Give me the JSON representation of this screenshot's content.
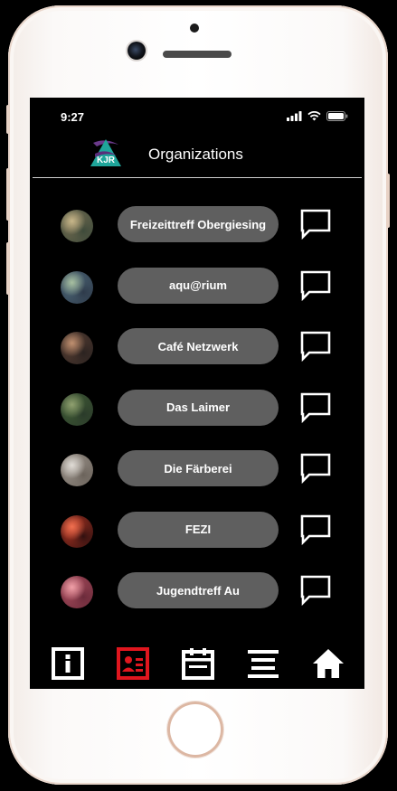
{
  "status_bar": {
    "time": "9:27"
  },
  "header": {
    "title": "Organizations",
    "logo_text": "KJR"
  },
  "organizations": [
    {
      "name": "Freizeittreff Obergiesing",
      "avatar_colors": [
        "#8a7a5a",
        "#c8b78a",
        "#3d4a3a"
      ]
    },
    {
      "name": "aqu@rium",
      "avatar_colors": [
        "#5a7a8a",
        "#a8c0a0",
        "#2e3a4a"
      ]
    },
    {
      "name": "Café Netzwerk",
      "avatar_colors": [
        "#6a4a3a",
        "#c09070",
        "#2a2220"
      ]
    },
    {
      "name": "Das Laimer",
      "avatar_colors": [
        "#4a6a3a",
        "#90a070",
        "#2a3a2a"
      ]
    },
    {
      "name": "Die Färberei",
      "avatar_colors": [
        "#b0a8a0",
        "#e0dcd6",
        "#6a625a"
      ]
    },
    {
      "name": "FEZI",
      "avatar_colors": [
        "#e0442a",
        "#f07050",
        "#301010"
      ]
    },
    {
      "name": "Jugendtreff Au",
      "avatar_colors": [
        "#c05a6a",
        "#f0a0a8",
        "#6a2a3a"
      ]
    }
  ],
  "bottom_nav": [
    {
      "id": "info",
      "icon": "info-icon",
      "active": false
    },
    {
      "id": "contacts",
      "icon": "contact-card-icon",
      "active": true
    },
    {
      "id": "calendar",
      "icon": "calendar-icon",
      "active": false
    },
    {
      "id": "menu",
      "icon": "menu-lines-icon",
      "active": false
    },
    {
      "id": "home",
      "icon": "home-icon",
      "active": false
    }
  ],
  "colors": {
    "background": "#000000",
    "pill": "#5f5f5f",
    "active_nav": "#e0161e",
    "text": "#ffffff",
    "logo_teal": "#1fa59a",
    "logo_purple": "#6a3a8a"
  }
}
